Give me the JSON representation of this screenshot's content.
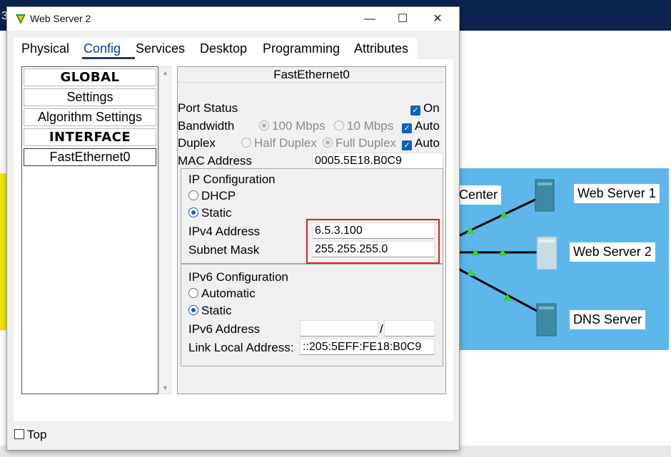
{
  "background": {
    "corner_digit": "3",
    "topology_labels": {
      "center": "Center",
      "web_server_1": "Web Server 1",
      "web_server_2": "Web Server 2",
      "dns_server": "DNS Server"
    }
  },
  "window": {
    "title": "Web Server 2",
    "controls": {
      "minimize": "—",
      "maximize": "☐",
      "close": "✕"
    }
  },
  "tabs": [
    {
      "label": "Physical"
    },
    {
      "label": "Config",
      "active": true
    },
    {
      "label": "Services"
    },
    {
      "label": "Desktop"
    },
    {
      "label": "Programming"
    },
    {
      "label": "Attributes"
    }
  ],
  "sidebar": {
    "items": [
      {
        "label": "GLOBAL",
        "header": true
      },
      {
        "label": "Settings"
      },
      {
        "label": "Algorithm Settings"
      },
      {
        "label": "INTERFACE",
        "header": true
      },
      {
        "label": "FastEthernet0",
        "selected": true
      }
    ]
  },
  "interface": {
    "title": "FastEthernet0",
    "port_status": {
      "label": "Port Status",
      "on_label": "On",
      "on": true
    },
    "bandwidth": {
      "label": "Bandwidth",
      "opt_100": "100 Mbps",
      "opt_10": "10 Mbps",
      "auto_label": "Auto",
      "auto": true
    },
    "duplex": {
      "label": "Duplex",
      "half": "Half Duplex",
      "full": "Full Duplex",
      "auto_label": "Auto",
      "auto": true
    },
    "mac": {
      "label": "MAC Address",
      "value": "0005.5E18.B0C9"
    },
    "ipv4": {
      "title": "IP Configuration",
      "dhcp_label": "DHCP",
      "static_label": "Static",
      "mode": "Static",
      "address_label": "IPv4 Address",
      "address_value": "6.5.3.100",
      "mask_label": "Subnet Mask",
      "mask_value": "255.255.255.0"
    },
    "ipv6": {
      "title": "IPv6 Configuration",
      "auto_label": "Automatic",
      "static_label": "Static",
      "mode": "Static",
      "address_label": "IPv6 Address",
      "address_value": "",
      "prefix_sep": "/",
      "prefix_value": "",
      "link_local_label": "Link Local Address:",
      "link_local_value": "::205:5EFF:FE18:B0C9"
    }
  },
  "footer": {
    "top_label": "Top",
    "top_checked": false
  },
  "colors": {
    "highlight": "#e02020",
    "accent": "#0a62c2",
    "canvas": "#5db7ea"
  }
}
